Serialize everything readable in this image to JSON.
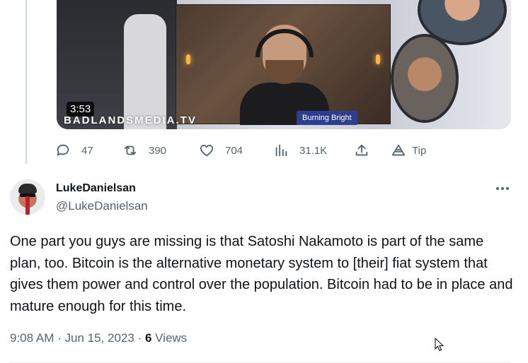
{
  "video": {
    "duration": "3:53",
    "brand": "BADLANDSMEDIA.TV",
    "lower_third": "Burning Bright"
  },
  "actions": {
    "replies": "47",
    "retweets": "390",
    "likes": "704",
    "views": "31.1K",
    "tip_label": "Tip"
  },
  "reply_tweet": {
    "author_name": "LukeDanielsan",
    "author_handle": "@LukeDanielsan",
    "text": "One part you guys are missing is that Satoshi Nakamoto is part of the same plan, too. Bitcoin is the alternative monetary system to [their] fiat system that gives them power and control over the population. Bitcoin had to be in place and mature enough for this time.",
    "time": "9:08 AM",
    "date": "Jun 15, 2023",
    "views_count": "6",
    "views_label": "Views"
  }
}
